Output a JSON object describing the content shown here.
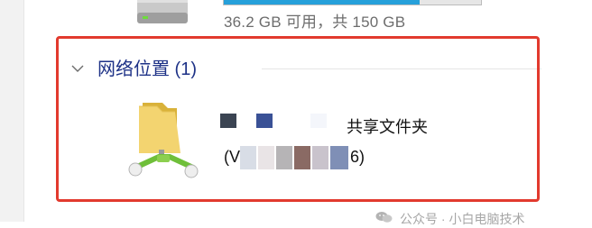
{
  "drive": {
    "space_text": "36.2 GB 可用，共 150 GB",
    "used_fraction": 0.76,
    "bar_color": "#26a0da"
  },
  "group": {
    "title": "网络位置 (1)",
    "chevron_icon": "chevron-down-icon",
    "title_color": "#1e3287"
  },
  "network_item": {
    "name": "共享文件夹",
    "address_prefix": "(V",
    "address_suffix": "6)",
    "icon": "network-share-folder-icon"
  },
  "highlight_color": "#e23a2e",
  "watermark": {
    "text": "公众号 · 小白电脑技术",
    "icon": "wechat-icon"
  }
}
